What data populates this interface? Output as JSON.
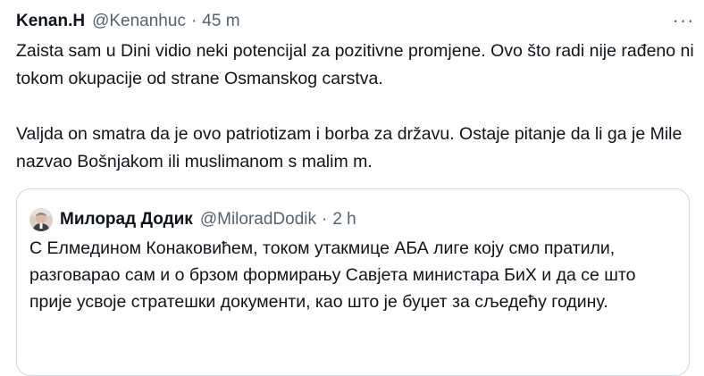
{
  "tweet": {
    "author_name": "Kenan.H",
    "author_handle": "@Kenanhuc",
    "separator": "·",
    "time": "45 m",
    "more_icon": "more-horizontal-icon",
    "paragraphs": [
      "Zaista sam u Dini vidio neki potencijal za pozitivne promjene. Ovo što radi nije rađeno ni tokom okupacije od strane Osmanskog carstva.",
      "Valjda on smatra da je ovo patriotizam i borba za državu. Ostaje pitanje da li ga je Mile nazvao Bošnjakom ili muslimanom s malim m."
    ]
  },
  "quoted_tweet": {
    "author_name": "Милорад Додик",
    "author_handle": "@MiloradDodik",
    "separator": "·",
    "time": "2 h",
    "text": "С Елмедином Конаковићем, током утакмице АБА лиге коју смо пратили, разговарао сам и о брзом формирању Савјета министара БиХ и да се што прије усвоје стратешки документи, као што је буџет за сљедећу годину."
  },
  "colors": {
    "text_primary": "#0f1419",
    "text_secondary": "#536471",
    "border": "#cfd9de"
  }
}
